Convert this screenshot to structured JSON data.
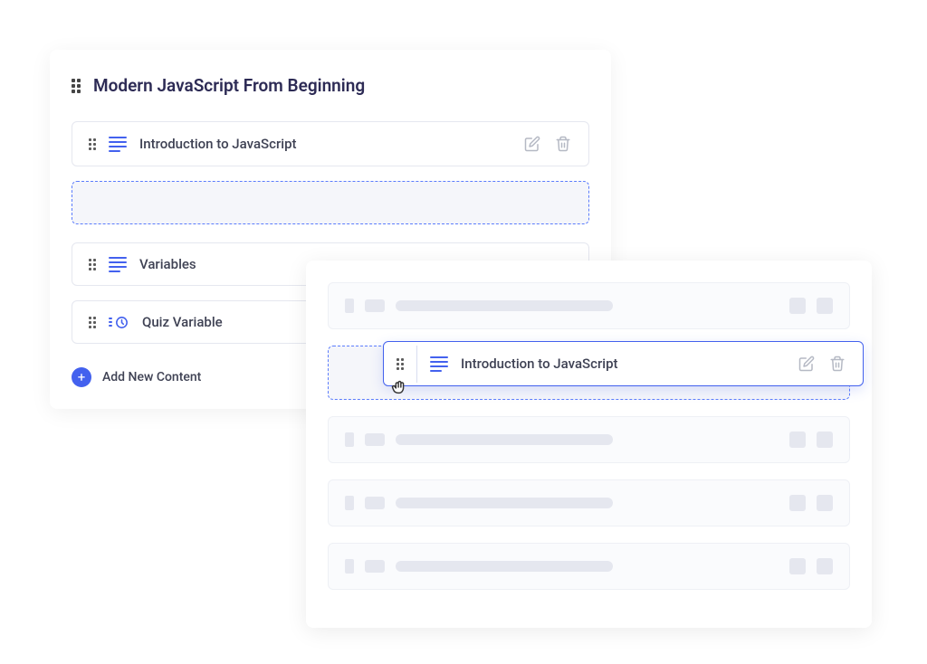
{
  "colors": {
    "accent": "#4361ee",
    "text_dark": "#2d2b55",
    "text_body": "#3f4254",
    "icon_muted": "#b5b9c4",
    "border": "#e5e7ef",
    "dashed_border": "#5b7cfc"
  },
  "leftPanel": {
    "title": "Modern JavaScript From Beginning",
    "rows": [
      {
        "type": "lesson",
        "title": "Introduction to JavaScript"
      },
      {
        "type": "lesson",
        "title": "Variables"
      },
      {
        "type": "quiz",
        "title": "Quiz Variable"
      }
    ],
    "addContentLabel": "Add New Content"
  },
  "rightPanel": {
    "draggingRowTitle": "Introduction to JavaScript"
  }
}
